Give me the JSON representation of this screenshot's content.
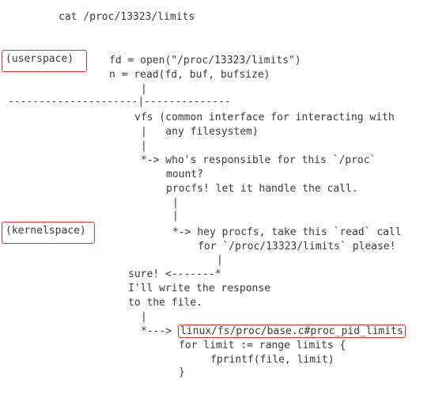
{
  "title_cmd": "cat /proc/13323/limits",
  "labels": {
    "userspace": "(userspace)",
    "kernelspace": "(kernelspace)"
  },
  "lines": {
    "l1": "fd = open(\"/proc/13323/limits\")",
    "l2": "n = read(fd, buf, bufsize)",
    "l3": "|",
    "l4": "---------------------|--------------",
    "l5": "vfs (common interface for interacting with",
    "l6": "|   any filesystem)",
    "l7": "|",
    "l8": "*-> who's responsible for this `/proc`",
    "l9": "mount?",
    "l10": "procfs! let it handle the call.",
    "l11": "|",
    "l12": "|",
    "l13": "*-> hey procfs, take this `read` call",
    "l14": "for `/proc/13323/limits` please!",
    "l15": "|",
    "l16": "sure! <-------*",
    "l17": "I'll write the response",
    "l18": "to the file.",
    "l19": "|",
    "l20_prefix": "*--->",
    "l20_link": "linux/fs/proc/base.c#proc_pid_limits",
    "l21": "for limit := range limits {",
    "l22": "fprintf(file, limit)",
    "l23": "}"
  },
  "colors": {
    "highlight_border": "#e0302f",
    "text": "#3a3a3a"
  }
}
